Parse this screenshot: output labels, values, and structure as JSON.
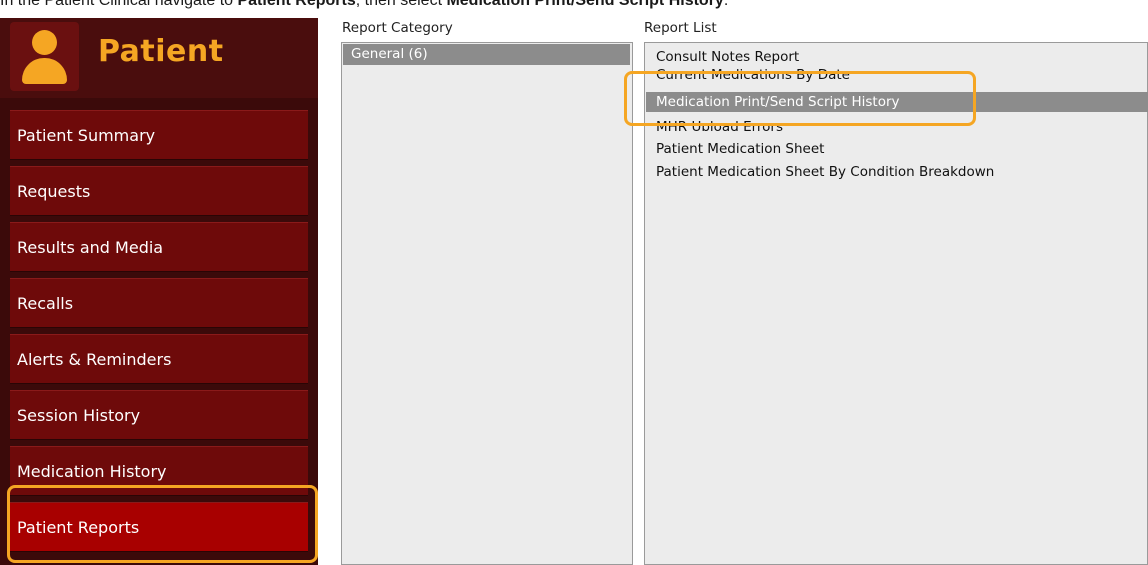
{
  "instruction": {
    "prefix": "In the Patient Clinical navigate to ",
    "bold1": "Patient Reports",
    "middle": ", then select ",
    "bold2": "Medication Print/Send Script History",
    "suffix": "."
  },
  "sidebar": {
    "title": "Patient",
    "items": [
      {
        "label": "Patient Summary"
      },
      {
        "label": "Requests"
      },
      {
        "label": "Results and Media"
      },
      {
        "label": "Recalls"
      },
      {
        "label": "Alerts & Reminders"
      },
      {
        "label": "Session History"
      },
      {
        "label": "Medication History"
      },
      {
        "label": "Patient Reports"
      }
    ],
    "active_item": "Patient Reports"
  },
  "report_category": {
    "label": "Report Category",
    "items": [
      {
        "label": "General (6)"
      }
    ]
  },
  "report_list": {
    "label": "Report List",
    "items": [
      {
        "label": "Consult Notes Report"
      },
      {
        "label": "Current Medications By Date"
      },
      {
        "label": "Medication Print/Send Script History"
      },
      {
        "label": "MHR Upload Errors"
      },
      {
        "label": "Patient Medication Sheet"
      },
      {
        "label": "Patient Medication Sheet By Condition Breakdown"
      }
    ],
    "selected_item": "Medication Print/Send Script History"
  },
  "colors": {
    "highlight": "#f5a623",
    "sidebar_bg": "#3b0a0a",
    "nav_item": "#6e0a0a",
    "nav_active": "#a80000",
    "selection": "#8c8c8c"
  }
}
